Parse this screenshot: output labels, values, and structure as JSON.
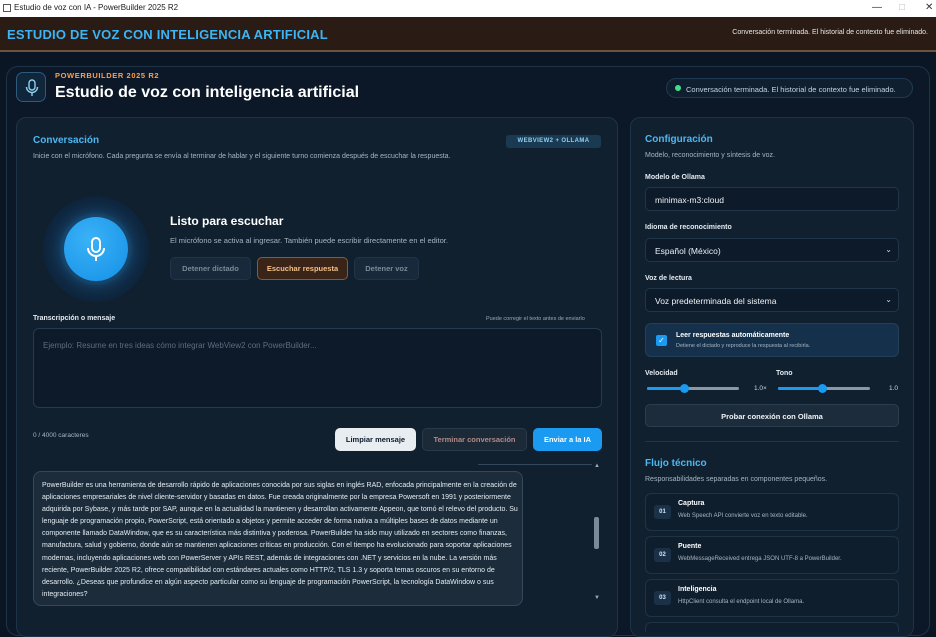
{
  "window": {
    "title": "Estudio de voz con IA - PowerBuilder 2025 R2",
    "controls": [
      "—",
      "□",
      "✕"
    ]
  },
  "header": {
    "title": "ESTUDIO DE VOZ CON INTELIGENCIA ARTIFICIAL",
    "status": "Conversación terminada. El historial de contexto fue eliminado."
  },
  "app": {
    "brand": "POWERBUILDER 2025 R2",
    "title": "Estudio de voz con inteligencia artificial",
    "status_pill": "Conversación terminada. El historial de contexto fue eliminado.",
    "icon": "microphone-icon"
  },
  "conversation": {
    "title": "Conversación",
    "subtitle": "Inicie con el micrófono. Cada pregunta se envía al terminar de hablar y el siguiente turno comienza después de escuchar la respuesta.",
    "badge": "WEBVIEW2 + OLLAMA",
    "ready_title": "Listo para escuchar",
    "ready_sub": "El micrófono se activa al ingresar. También puede escribir directamente en el editor.",
    "buttons": {
      "stop_dictation": "Detener dictado",
      "listen_response": "Escuchar respuesta",
      "stop_voice": "Detener voz"
    },
    "transcript_label": "Transcripción o mensaje",
    "transcript_hint": "Puede corregir el texto antes de enviarlo",
    "placeholder": "Ejemplo: Resume en tres ideas cómo integrar WebView2 con PowerBuilder...",
    "char_count": "0 / 4000 caracteres",
    "actions": {
      "clear": "Limpiar mensaje",
      "end": "Terminar conversación",
      "send": "Enviar a la IA"
    },
    "response": "PowerBuilder es una herramienta de desarrollo rápido de aplicaciones conocida por sus siglas en inglés RAD, enfocada principalmente en la creación de aplicaciones empresariales de nivel cliente-servidor y basadas en datos. Fue creada originalmente por la empresa Powersoft en 1991 y posteriormente adquirida por Sybase, y más tarde por SAP, aunque en la actualidad la mantienen y desarrollan activamente Appeon, que tomó el relevo del producto. Su lenguaje de programación propio, PowerScript, está orientado a objetos y permite acceder de forma nativa a múltiples bases de datos mediante un componente llamado DataWindow, que es su característica más distintiva y poderosa. PowerBuilder ha sido muy utilizado en sectores como finanzas, manufactura, salud y gobierno, donde aún se mantienen aplicaciones críticas en producción. Con el tiempo ha evolucionado para soportar aplicaciones modernas, incluyendo aplicaciones web con PowerServer y APIs REST, además de integraciones con .NET y servicios en la nube. La versión más reciente, PowerBuilder 2025 R2, ofrece compatibilidad con estándares actuales como HTTP/2, TLS 1.3 y soporta temas oscuros en su entorno de desarrollo. ¿Deseas que profundice en algún aspecto particular como su lenguaje de programación PowerScript, la tecnología DataWindow o sus integraciones?"
  },
  "config": {
    "title": "Configuración",
    "subtitle": "Modelo, reconocimiento y síntesis de voz.",
    "model_label": "Modelo de Ollama",
    "model_value": "minimax-m3:cloud",
    "lang_label": "Idioma de reconocimiento",
    "lang_value": "Español (México)",
    "voice_label": "Voz de lectura",
    "voice_value": "Voz predeterminada del sistema",
    "auto_read_title": "Leer respuestas automáticamente",
    "auto_read_sub": "Detiene el dictado y reproduce la respuesta al recibirla.",
    "auto_read_checked": true,
    "speed_label": "Velocidad",
    "speed_value": "1.0×",
    "speed_level": 1.0,
    "tone_label": "Tono",
    "tone_value": "1.0",
    "tone_level": 1.0,
    "test_button": "Probar conexión con Ollama"
  },
  "flow": {
    "title": "Flujo técnico",
    "subtitle": "Responsabilidades separadas en componentes pequeños.",
    "steps": [
      {
        "num": "01",
        "title": "Captura",
        "desc": "Web Speech API convierte voz en texto editable."
      },
      {
        "num": "02",
        "title": "Puente",
        "desc": "WebMessageReceived entrega JSON UTF-8 a PowerBuilder."
      },
      {
        "num": "03",
        "title": "Inteligencia",
        "desc": "HttpClient consulta el endpoint local de Ollama."
      }
    ]
  },
  "colors": {
    "accent": "#1a9af0",
    "brand_orange": "#ff9f4a",
    "status_green": "#3ee08a",
    "header_title": "#3bb5f5"
  }
}
